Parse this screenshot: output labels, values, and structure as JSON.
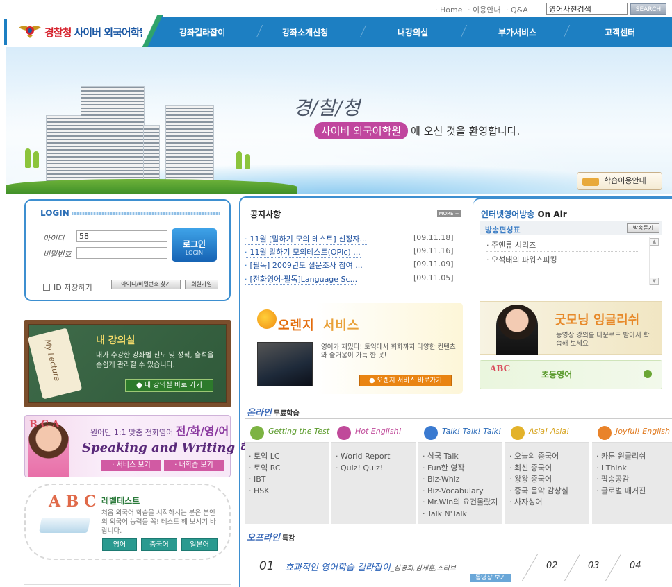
{
  "top_links": {
    "home": "· Home",
    "guide": "· 이용안내",
    "qa": "· Q&A",
    "search_value": "영어사전검색",
    "search_btn": "SEARCH"
  },
  "logo": {
    "part1": "경찰청",
    "part2": " 사이버 외국어학원"
  },
  "nav": [
    "강좌길라잡이",
    "강좌소개신청",
    "내강의실",
    "부가서비스",
    "고객센터"
  ],
  "banner": {
    "title": "경/찰/청",
    "pill": "사이버 외국어학원",
    "welcome": "에 오신 것을 환영합니다.",
    "guide_btn": "학습이용안내"
  },
  "login": {
    "title": "LOGIN",
    "id_label": "아이디",
    "id_value": "58",
    "pw_label": "비밀번호",
    "btn": "로그인",
    "btn_sub": "LOGIN",
    "save_id": "ID 저장하기",
    "find_btn": "아이디/비밀번호 찾기",
    "join_btn": "회원가입"
  },
  "lecture": {
    "tag": "My Lecture",
    "title": "내 강의실",
    "desc": "내가 수강한 강좌별 진도 및 성적, 출석을 손쉽게 관리할 수 있습니다.",
    "btn": "● 내 강의실 바로 가기"
  },
  "phone": {
    "abc": "B C A",
    "line1": "원어민 1:1 맞춤 전화영어 ",
    "line1b": "전/화/영/어",
    "line2": "Speaking and Writing 해결",
    "btn1": "· 서비스 보기",
    "btn2": "· 내학습 보기"
  },
  "level": {
    "abc": "A B C",
    "title": "레벨테스트",
    "desc": "처음 외국어 학습을 시작하시는 분은 본인의 외국어 능력을 꼭! 테스트 해 보시기 바랍니다.",
    "btns": [
      "영어",
      "중국어",
      "일본어"
    ]
  },
  "notice": {
    "title": "공지사항",
    "more": "MORE +",
    "items": [
      {
        "title": "11월 [말하기 모의 테스트] 선정자...",
        "date": "[09.11.18]"
      },
      {
        "title": "11월 말하기 모의테스트(OPIc) ...",
        "date": "[09.11.16]"
      },
      {
        "title": "[필독] 2009년도 설문조사 참여 ...",
        "date": "[09.11.09]"
      },
      {
        "title": "[전화영어-필독]Language Sc...",
        "date": "[09.11.05]"
      }
    ]
  },
  "onair": {
    "title": "인터넷영어방송",
    "suffix": " On Air",
    "sched": "방송편성표",
    "listen": "방송듣기",
    "items": [
      "· 주앤류 시리즈",
      "· 오석태의 파워스피킹"
    ]
  },
  "orange": {
    "title": "오렌지",
    "title2": "서비스",
    "desc": "영어가 재밌다! 토익에서 회화까지 다양한 컨텐츠와 즐거움이 가득 한 곳!",
    "btn": "● 오렌지 서비스 바로가기"
  },
  "goodmorning": {
    "title": "굿모닝 잉글리쉬",
    "desc": "동영상 강의를 다운로드 받아서 학습해 보세요"
  },
  "kid": {
    "abc": "ABC",
    "title": "초등영어"
  },
  "free": {
    "head": "온라인",
    "sub": "무료학습",
    "cols": [
      {
        "name": "Getting the Test",
        "color": "#5a9a2a",
        "icon": "#7cb342",
        "items": [
          "토익 LC",
          "토익 RC",
          "IBT",
          "HSK"
        ]
      },
      {
        "name": "Hot English!",
        "color": "#c04a9a",
        "icon": "#c04a9a",
        "items": [
          "World Report",
          "Quiz! Quiz!"
        ]
      },
      {
        "name": "Talk! Talk! Talk!",
        "color": "#2a6ab8",
        "icon": "#3a7ad0",
        "items": [
          "삼국 Talk",
          "Fun한 영작",
          "Biz-Whiz",
          "Biz-Vocabulary",
          "Mr.Win의 요건몰랐지",
          "Talk N'Talk"
        ]
      },
      {
        "name": "Asia! Asia!",
        "color": "#d6a21a",
        "icon": "#e3b22a",
        "items": [
          "오늘의 중국어",
          "최신 중국어",
          "왕왕 중국어",
          "중국 음악 감상실",
          "사자성어"
        ]
      },
      {
        "name": "Joyful! English",
        "color": "#e07a20",
        "icon": "#e9832a",
        "items": [
          "카툰 윈글리쉬",
          "I Think",
          "팝송공감",
          "글로벌 매거진"
        ]
      }
    ]
  },
  "special": {
    "head": "오프라인",
    "sub": "특강",
    "num": "01",
    "title": "효과적인 영어학습 길라잡이",
    "authors": "_심경희,김세훈,스티브",
    "btn": "동영상 보기",
    "pages": [
      "02",
      "03",
      "04"
    ]
  }
}
